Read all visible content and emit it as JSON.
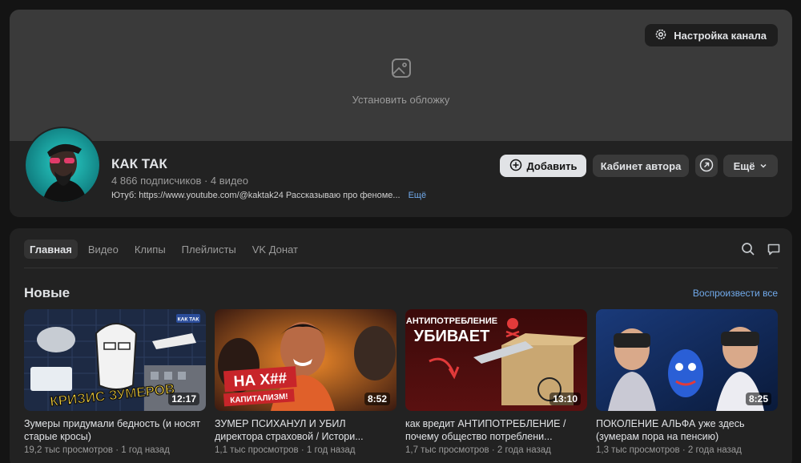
{
  "cover": {
    "settings_button": "Настройка канала",
    "set_cover_label": "Установить обложку"
  },
  "channel": {
    "name": "КАК ТАК",
    "meta": "4 866 подписчиков · 4 видео",
    "description": "Ютуб: https://www.youtube.com/@kaktak24 Рассказываю про феноме...",
    "more_link": "Ещё"
  },
  "actions": {
    "add_label": "Добавить",
    "cabinet_label": "Кабинет автора",
    "more_label": "Ещё"
  },
  "tabs": [
    {
      "label": "Главная",
      "active": true
    },
    {
      "label": "Видео",
      "active": false
    },
    {
      "label": "Клипы",
      "active": false
    },
    {
      "label": "Плейлисты",
      "active": false
    },
    {
      "label": "VK Донат",
      "active": false
    }
  ],
  "section": {
    "title": "Новые",
    "play_all": "Воспроизвести все"
  },
  "videos": [
    {
      "title": "Зумеры придумали бедность (и носят старые кросы)",
      "meta": "19,2 тыс просмотров · 1 год назад",
      "duration": "12:17",
      "thumb_text": "КРИЗИС ЗУМЕРОВ",
      "thumb_badge": "КАК ТАК"
    },
    {
      "title": "ЗУМЕР ПСИХАНУЛ И УБИЛ директора страховой / Истори...",
      "meta": "1,1 тыс просмотров · 1 год назад",
      "duration": "8:52",
      "thumb_text_1": "НА Х##",
      "thumb_text_2": "КАПИТАЛИЗМ!"
    },
    {
      "title": "как вредит АНТИПОТРЕБЛЕНИЕ / почему общество потреблени...",
      "meta": "1,7 тыс просмотров · 2 года назад",
      "duration": "13:10",
      "thumb_text_1": "АНТИПОТРЕБЛЕНИЕ",
      "thumb_text_2": "УБИВАЕТ"
    },
    {
      "title": "ПОКОЛЕНИЕ АЛЬФА уже здесь (зумерам пора на пенсию)",
      "meta": "1,3 тыс просмотров · 2 года назад",
      "duration": "8:25"
    }
  ],
  "icons": {
    "settings": "gear-icon",
    "cover": "image-icon",
    "add": "plus-circle-icon",
    "share": "arrow-up-right-icon",
    "more": "chevron-down-icon",
    "search": "search-icon",
    "comments": "chat-icon"
  }
}
